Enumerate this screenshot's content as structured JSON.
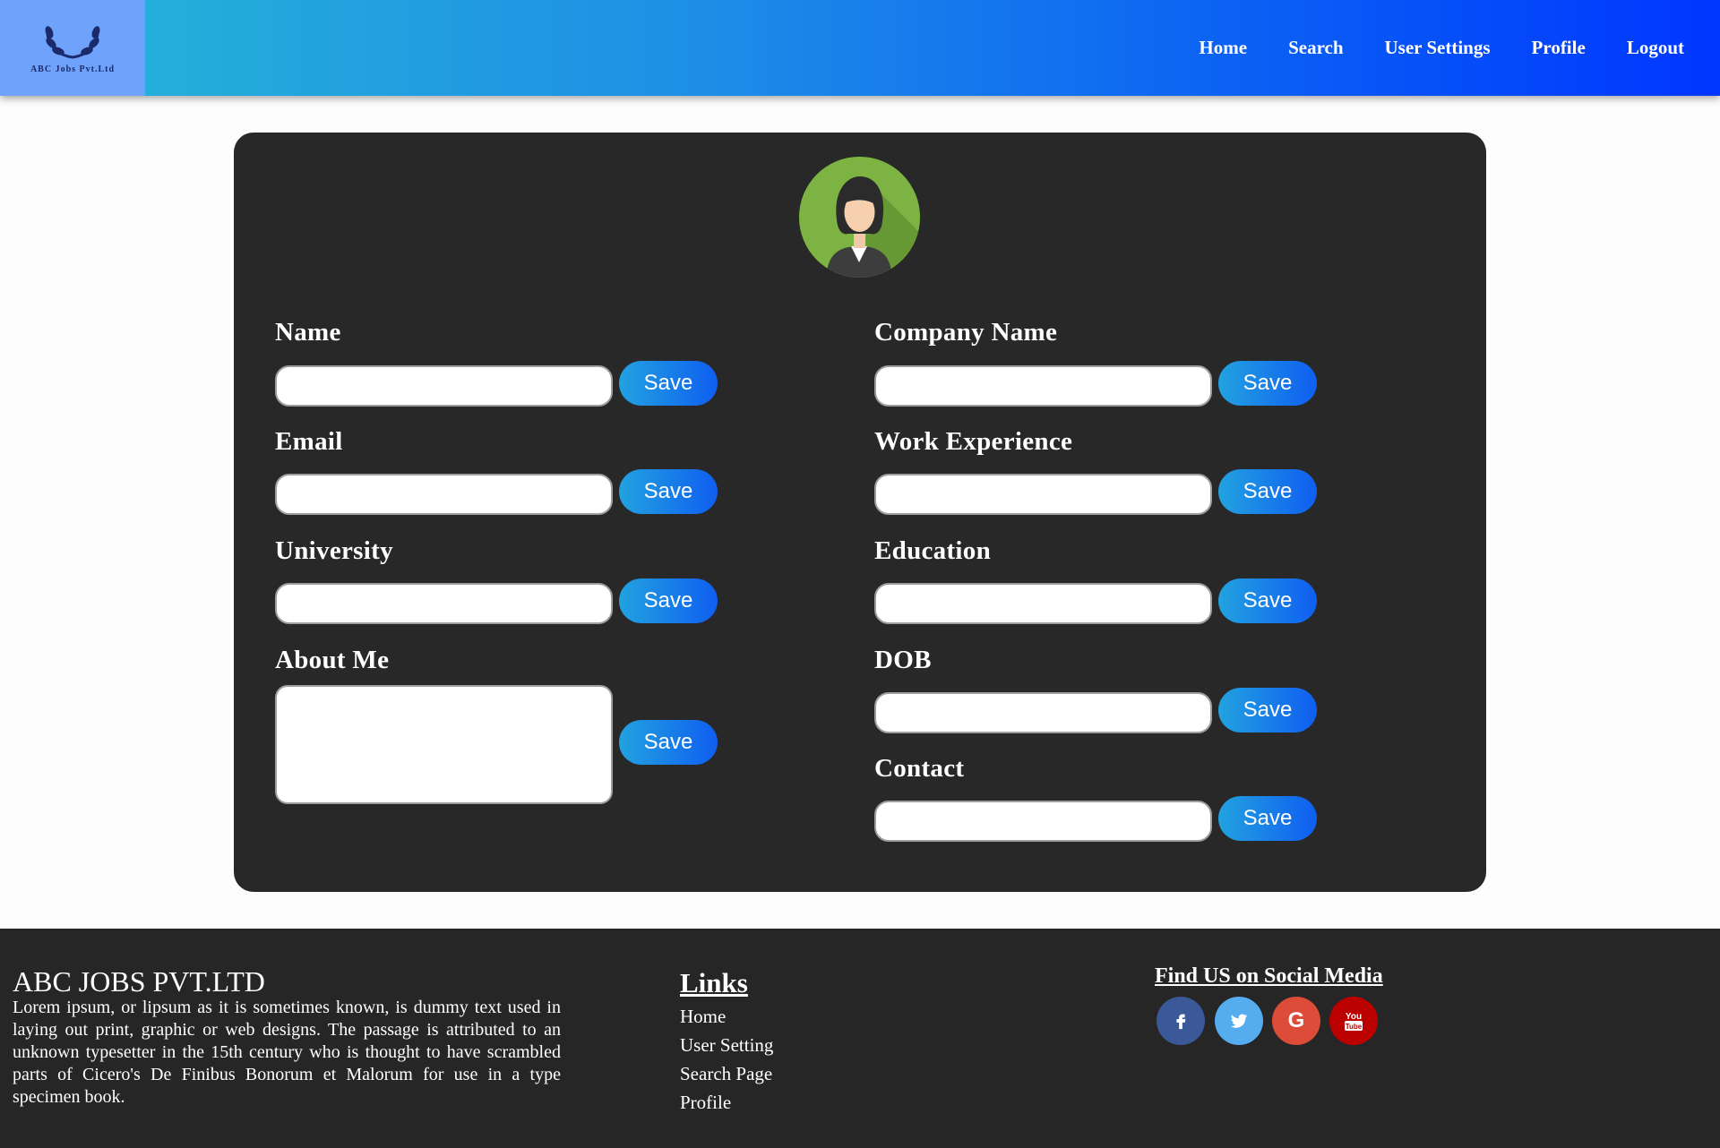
{
  "header": {
    "logo_text": "ABC Jobs Pvt.Ltd",
    "nav": [
      "Home",
      "Search",
      "User Settings",
      "Profile",
      "Logout"
    ]
  },
  "form": {
    "left_fields": [
      {
        "label": "Name",
        "value": "",
        "save": "Save"
      },
      {
        "label": "Email",
        "value": "",
        "save": "Save"
      },
      {
        "label": "University",
        "value": "",
        "save": "Save"
      },
      {
        "label": "About Me",
        "value": "",
        "save": "Save"
      }
    ],
    "right_fields": [
      {
        "label": "Company Name",
        "value": "",
        "save": "Save"
      },
      {
        "label": "Work Experience",
        "value": "",
        "save": "Save"
      },
      {
        "label": "Education",
        "value": "",
        "save": "Save"
      },
      {
        "label": "DOB",
        "value": "",
        "save": "Save"
      },
      {
        "label": "Contact",
        "value": "",
        "save": "Save"
      }
    ]
  },
  "footer": {
    "company": "ABC JOBS PVT.LTD",
    "description": "Lorem ipsum, or lipsum as it is sometimes known, is dummy text used in laying out print, graphic or web designs. The passage is attributed to an unknown typesetter in the 15th century who is thought to have scrambled parts of Cicero's De Finibus Bonorum et Malorum for use in a type specimen book.",
    "links_title": "Links",
    "links": [
      "Home",
      "User Setting",
      "Search Page",
      "Profile"
    ],
    "social_title": "Find US on Social Media",
    "social": [
      {
        "icon": "facebook-icon",
        "glyph": "f",
        "color": "#3b5998"
      },
      {
        "icon": "twitter-icon",
        "glyph": "t",
        "color": "#55acee"
      },
      {
        "icon": "google-icon",
        "glyph": "G",
        "color": "#dd4b39"
      },
      {
        "icon": "youtube-icon",
        "glyph": "You Tube",
        "color": "#bb0000"
      }
    ]
  }
}
